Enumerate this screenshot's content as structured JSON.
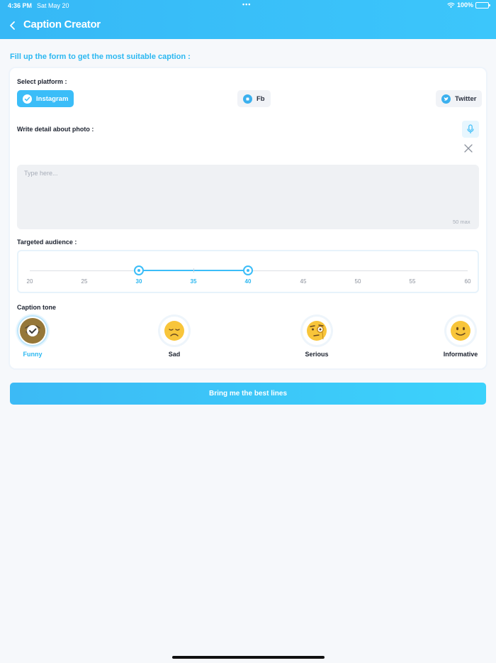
{
  "status_bar": {
    "time": "4:36 PM",
    "date": "Sat May 20",
    "battery": "100%"
  },
  "header": {
    "title": "Caption Creator"
  },
  "intro": "Fill up the form to get the most suitable caption :",
  "platform": {
    "label": "Select platform :",
    "options": [
      {
        "label": "Instagram",
        "selected": true
      },
      {
        "label": "Fb",
        "selected": false
      },
      {
        "label": "Twitter",
        "selected": false
      }
    ]
  },
  "detail": {
    "label": "Write detail about photo :",
    "placeholder": "Type here...",
    "limit": "50 max",
    "value": ""
  },
  "audience": {
    "label": "Targeted audience :",
    "ticks": [
      "20",
      "25",
      "30",
      "35",
      "40",
      "45",
      "50",
      "55",
      "60"
    ],
    "min_selected": 30,
    "max_selected": 40
  },
  "tone": {
    "label": "Caption tone",
    "options": [
      {
        "label": "Funny",
        "selected": true
      },
      {
        "label": "Sad",
        "selected": false
      },
      {
        "label": "Serious",
        "selected": false
      },
      {
        "label": "Informative",
        "selected": false
      }
    ]
  },
  "cta": {
    "label": "Bring me the best lines"
  },
  "colors": {
    "accent": "#3bbdf8",
    "header": "#36b8f6",
    "background": "#f6f8fb"
  }
}
